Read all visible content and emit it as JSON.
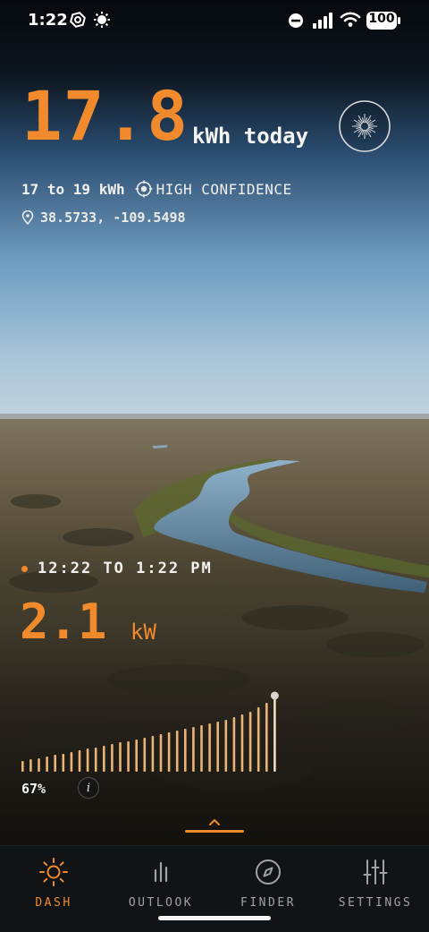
{
  "status_bar": {
    "time": "1:22",
    "battery": "100",
    "icons": [
      "nfc-icon",
      "brightness-icon",
      "do-not-disturb-icon",
      "signal-icon",
      "wifi-icon",
      "battery-icon"
    ]
  },
  "summary": {
    "energy_value": "17.8",
    "energy_unit": "kWh today",
    "range": "17 to 19 kWh",
    "confidence": "HIGH CONFIDENCE",
    "coordinates": "38.5733, -109.5498"
  },
  "window": {
    "time_range": "12:22 TO 1:22 PM",
    "power_value": "2.1",
    "power_unit": "kW",
    "percent": "67%",
    "percent_value": 67,
    "info_label": "i"
  },
  "chart_data": {
    "type": "bar",
    "title": "",
    "xlabel": "",
    "ylabel": "",
    "values": [
      0.12,
      0.14,
      0.15,
      0.17,
      0.19,
      0.2,
      0.22,
      0.24,
      0.26,
      0.27,
      0.29,
      0.31,
      0.33,
      0.34,
      0.36,
      0.38,
      0.4,
      0.42,
      0.44,
      0.46,
      0.48,
      0.5,
      0.52,
      0.54,
      0.56,
      0.58,
      0.61,
      0.64,
      0.67,
      0.72,
      0.77,
      0.83
    ],
    "current_index": 31,
    "ylim": [
      0,
      1
    ]
  },
  "tabs": [
    {
      "label": "DASH",
      "icon": "sun-icon",
      "active": true
    },
    {
      "label": "OUTLOOK",
      "icon": "bar-chart-icon",
      "active": false
    },
    {
      "label": "FINDER",
      "icon": "compass-icon",
      "active": false
    },
    {
      "label": "SETTINGS",
      "icon": "sliders-icon",
      "active": false
    }
  ],
  "colors": {
    "accent": "#f08a2c",
    "tab_inactive": "#a0a3a6",
    "tabbar_bg": "#111416"
  }
}
